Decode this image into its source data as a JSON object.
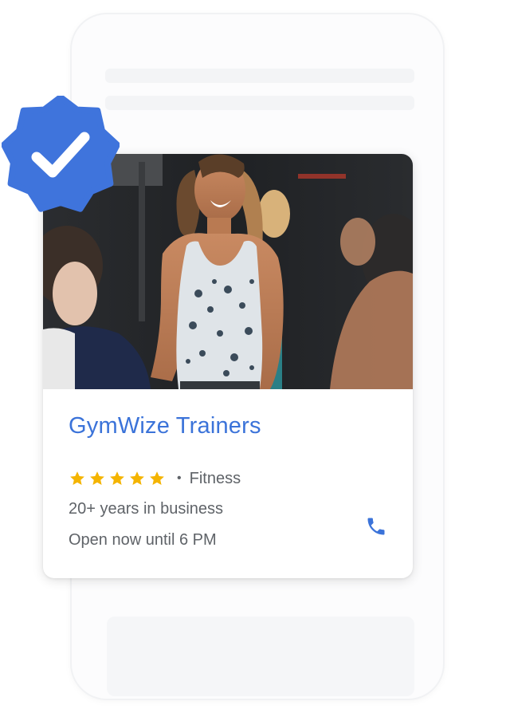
{
  "business": {
    "name": "GymWize Trainers",
    "rating": 5,
    "rating_max": 5,
    "separator": "•",
    "category": "Fitness",
    "years": "20+ years in business",
    "hours": "Open now until 6 PM"
  },
  "icons": {
    "badge": "verified-badge-icon",
    "phone": "phone-icon",
    "star": "star-icon"
  },
  "colors": {
    "brand_blue": "#3b73d9",
    "badge_blue": "#3f74dc",
    "star_yellow": "#f4b400",
    "text_gray": "#5f6368"
  }
}
